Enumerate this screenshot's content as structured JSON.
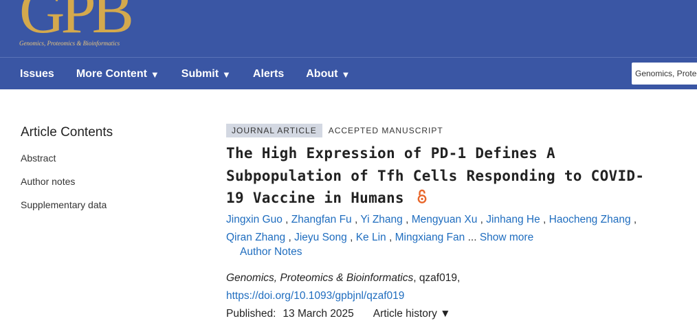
{
  "header": {
    "logo_text": "GPB",
    "logo_subtitle": "Genomics, Proteomics & Bioinformatics",
    "colors": {
      "header_bg": "#3a56a4",
      "logo": "#d4a94d"
    }
  },
  "nav": {
    "items": [
      {
        "label": "Issues",
        "dropdown": false
      },
      {
        "label": "More Content",
        "dropdown": true
      },
      {
        "label": "Submit",
        "dropdown": true
      },
      {
        "label": "Alerts",
        "dropdown": false
      },
      {
        "label": "About",
        "dropdown": true
      }
    ],
    "search_value": "Genomics, Proteomics"
  },
  "sidebar": {
    "title": "Article Contents",
    "items": [
      "Abstract",
      "Author notes",
      "Supplementary data"
    ]
  },
  "article": {
    "tag_type": "JOURNAL ARTICLE",
    "tag_status": "ACCEPTED MANUSCRIPT",
    "title": "The High Expression of PD-1 Defines A Subpopulation of Tfh Cells Responding to COVID-19 Vaccine in Humans",
    "open_access_icon": "open-access-icon",
    "authors": [
      "Jingxin Guo",
      "Zhangfan Fu",
      "Yi Zhang",
      "Mengyuan Xu",
      "Jinhang He",
      "Haocheng Zhang",
      "Qiran Zhang",
      "Jieyu Song",
      "Ke Lin",
      "Mingxiang Fan"
    ],
    "ellipsis": "...",
    "show_more": "Show more",
    "author_notes": "Author Notes",
    "journal": "Genomics, Proteomics & Bioinformatics",
    "article_id": ", qzaf019,",
    "doi": "https://doi.org/10.1093/gpbjnl/qzaf019",
    "published_label": "Published:",
    "published_date": "13 March 2025",
    "history_label": "Article history ▼",
    "colors": {
      "link": "#1f6dbf",
      "oa": "#e8662a"
    }
  }
}
